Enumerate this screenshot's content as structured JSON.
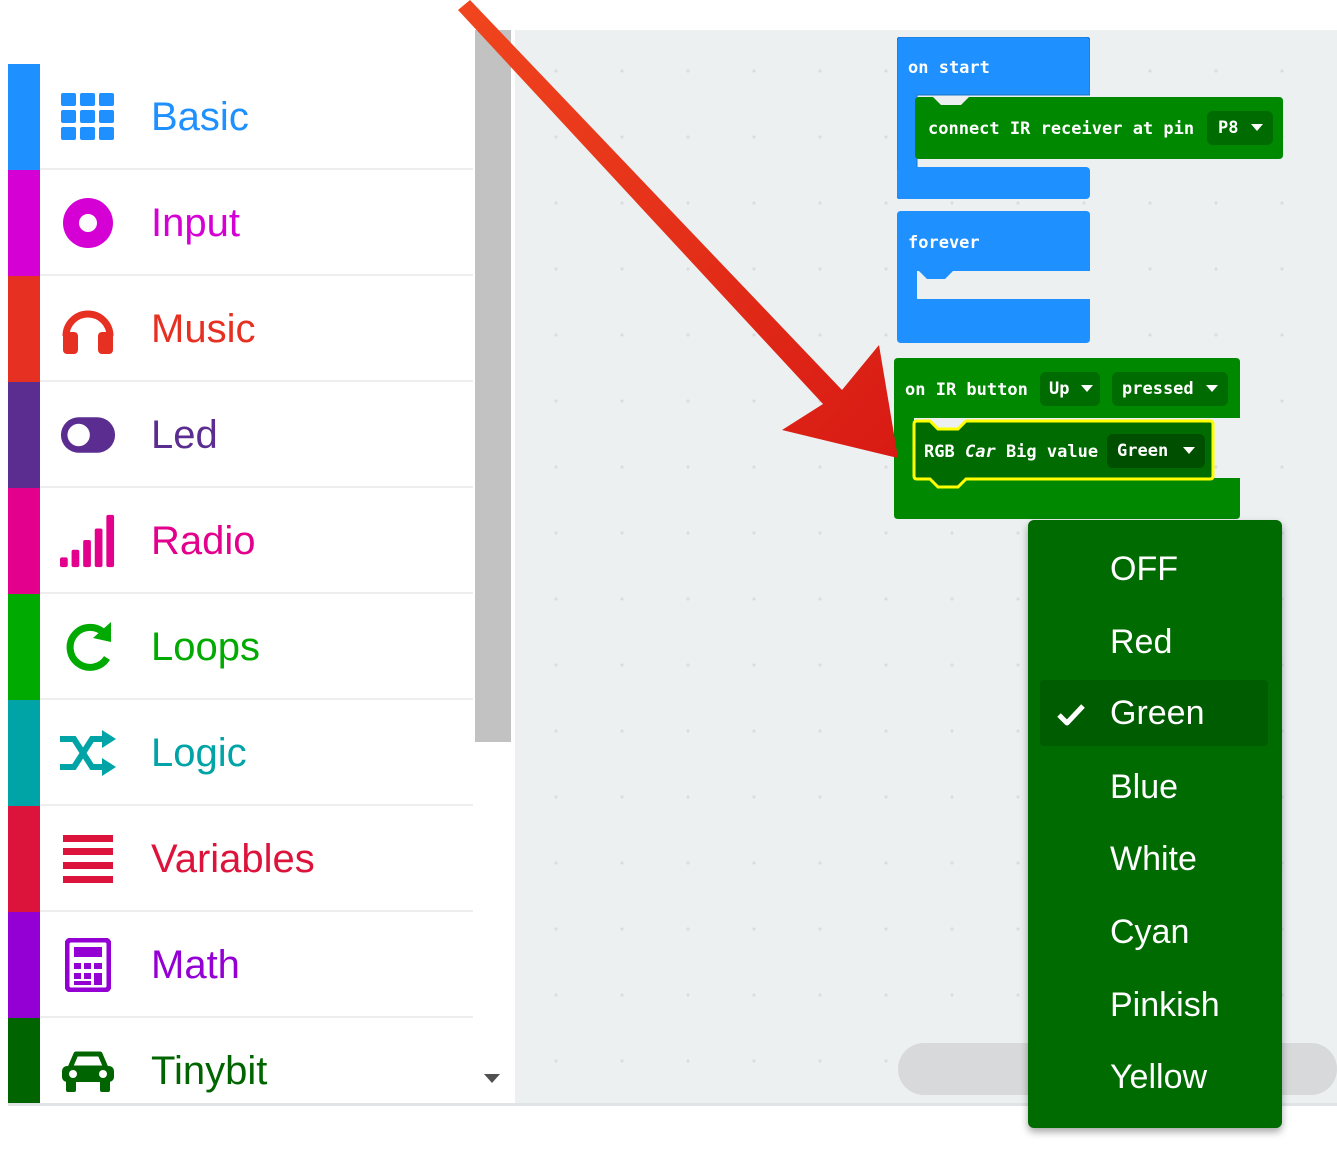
{
  "toolbox": {
    "categories": [
      {
        "label": "Basic",
        "icon": "grid-icon",
        "color": "#1e90ff"
      },
      {
        "label": "Input",
        "icon": "target-circle-icon",
        "color": "#d400d4"
      },
      {
        "label": "Music",
        "icon": "headphones-icon",
        "color": "#e63022"
      },
      {
        "label": "Led",
        "icon": "toggle-icon",
        "color": "#5c2d91"
      },
      {
        "label": "Radio",
        "icon": "signal-bars-icon",
        "color": "#e3008c"
      },
      {
        "label": "Loops",
        "icon": "refresh-icon",
        "color": "#00aa00"
      },
      {
        "label": "Logic",
        "icon": "shuffle-icon",
        "color": "#00a4a6"
      },
      {
        "label": "Variables",
        "icon": "list-lines-icon",
        "color": "#dc143c"
      },
      {
        "label": "Math",
        "icon": "calculator-icon",
        "color": "#9400d3"
      },
      {
        "label": "Tinybit",
        "icon": "car-icon",
        "color": "#006400"
      }
    ]
  },
  "blocks": {
    "on_start": {
      "label": "on start",
      "color": "#1e90ff"
    },
    "connect_ir": {
      "label": "connect IR receiver at pin",
      "pin": "P8",
      "color": "#008800"
    },
    "forever": {
      "label": "forever",
      "color": "#1e90ff"
    },
    "on_ir_button": {
      "prefix": "on IR button",
      "button": "Up",
      "event": "pressed",
      "color": "#008800"
    },
    "rgb_car": {
      "part1": "RGB",
      "part2": "Car",
      "part3": "Big value",
      "value": "Green",
      "highlight": "#ffff00"
    }
  },
  "dropdown": {
    "selected": "Green",
    "options": [
      "OFF",
      "Red",
      "Green",
      "Blue",
      "White",
      "Cyan",
      "Pinkish",
      "Yellow"
    ],
    "bg": "#006b00"
  },
  "annotation": {
    "icon": "pointer-arrow-icon",
    "color": "#e8321a"
  }
}
